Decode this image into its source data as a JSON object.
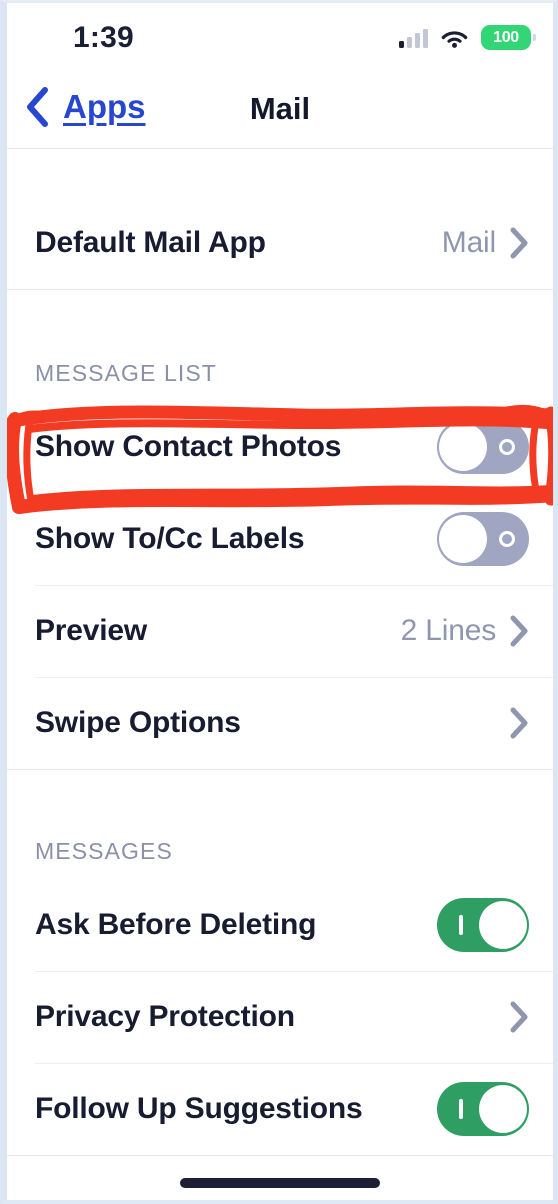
{
  "status_bar": {
    "time": "1:39",
    "battery_percent": "100",
    "cellular_icon": "cellular-signal-icon",
    "wifi_icon": "wifi-icon",
    "battery_icon": "battery-icon"
  },
  "nav": {
    "back_label": "Apps",
    "back_icon": "chevron-left-icon",
    "title": "Mail"
  },
  "sections": [
    {
      "header": "",
      "rows": [
        {
          "label": "Default Mail App",
          "value": "Mail",
          "control": "chevron",
          "name": "row-default-mail-app"
        }
      ]
    },
    {
      "header": "MESSAGE LIST",
      "rows": [
        {
          "label": "Show Contact Photos",
          "value": "",
          "control": "toggle-off",
          "name": "row-show-contact-photos",
          "annotated": true
        },
        {
          "label": "Show To/Cc Labels",
          "value": "",
          "control": "toggle-off",
          "name": "row-show-to-cc-labels"
        },
        {
          "label": "Preview",
          "value": "2 Lines",
          "control": "chevron",
          "name": "row-preview"
        },
        {
          "label": "Swipe Options",
          "value": "",
          "control": "chevron",
          "name": "row-swipe-options"
        }
      ]
    },
    {
      "header": "MESSAGES",
      "rows": [
        {
          "label": "Ask Before Deleting",
          "value": "",
          "control": "toggle-on",
          "name": "row-ask-before-deleting"
        },
        {
          "label": "Privacy Protection",
          "value": "",
          "control": "chevron",
          "name": "row-privacy-protection"
        },
        {
          "label": "Follow Up Suggestions",
          "value": "",
          "control": "toggle-on",
          "name": "row-follow-up-suggestions"
        }
      ]
    }
  ],
  "annotation": {
    "type": "hand-drawn-rectangle",
    "color": "#f23b22",
    "targets": "Show Contact Photos"
  },
  "colors": {
    "link": "#2847d0",
    "toggle_on": "#2e9e63",
    "toggle_off": "#a0a5c2",
    "battery": "#32d674",
    "text": "#181c30",
    "secondary_text": "#9096ad",
    "annotation_red": "#f23b22"
  },
  "home_indicator": "home-indicator"
}
